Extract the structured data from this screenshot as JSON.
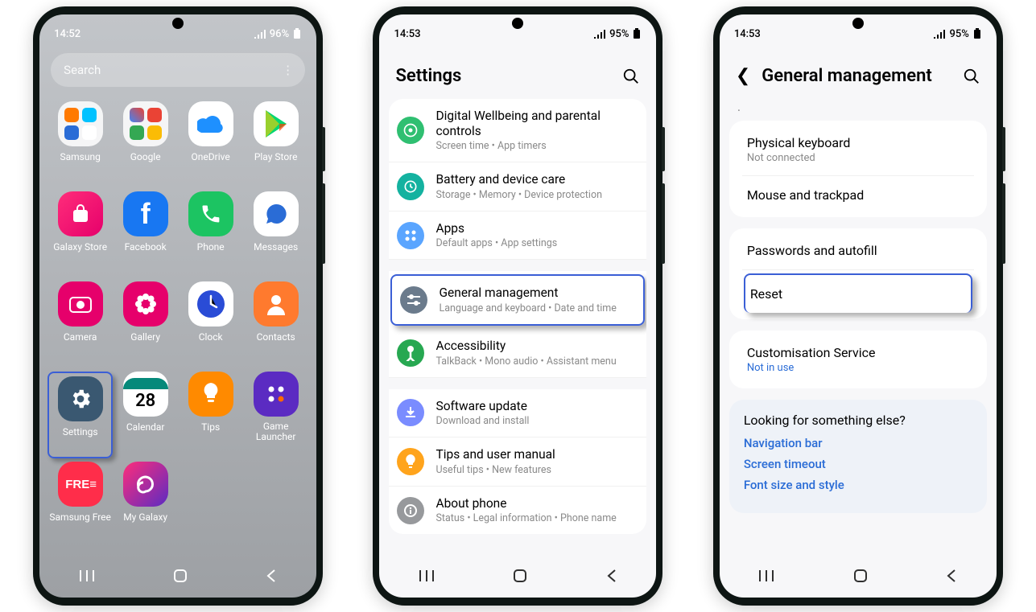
{
  "phone1": {
    "status": {
      "time": "14:52",
      "battery": "96%"
    },
    "search_placeholder": "Search",
    "apps": [
      {
        "label": "Samsung"
      },
      {
        "label": "Google"
      },
      {
        "label": "OneDrive"
      },
      {
        "label": "Play Store"
      },
      {
        "label": "Galaxy Store"
      },
      {
        "label": "Facebook"
      },
      {
        "label": "Phone"
      },
      {
        "label": "Messages"
      },
      {
        "label": "Camera"
      },
      {
        "label": "Gallery"
      },
      {
        "label": "Clock"
      },
      {
        "label": "Contacts"
      },
      {
        "label": "Settings",
        "highlight": true
      },
      {
        "label": "Calendar"
      },
      {
        "label": "Tips"
      },
      {
        "label": "Game Launcher"
      },
      {
        "label": "Samsung Free"
      },
      {
        "label": "My Galaxy"
      }
    ],
    "calendar_day": "28"
  },
  "phone2": {
    "status": {
      "time": "14:53",
      "battery": "95%"
    },
    "header": "Settings",
    "items": [
      {
        "title": "Digital Wellbeing and parental controls",
        "sub": "Screen time  •  App timers",
        "color": "#2fbf71"
      },
      {
        "title": "Battery and device care",
        "sub": "Storage  •  Memory  •  Device protection",
        "color": "#14b2a0"
      },
      {
        "title": "Apps",
        "sub": "Default apps  •  App settings",
        "color": "#5aa5ff"
      },
      {
        "title": "General management",
        "sub": "Language and keyboard  •  Date and time",
        "color": "#6b7b8c",
        "highlight": true
      },
      {
        "title": "Accessibility",
        "sub": "TalkBack  •  Mono audio  •  Assistant menu",
        "color": "#27a851"
      },
      {
        "title": "Software update",
        "sub": "Download and install",
        "color": "#7a8cff"
      },
      {
        "title": "Tips and user manual",
        "sub": "Useful tips  •  New features",
        "color": "#ffa41c"
      },
      {
        "title": "About phone",
        "sub": "Status  •  Legal information  •  Phone name",
        "color": "#97999c"
      }
    ]
  },
  "phone3": {
    "status": {
      "time": "14:53",
      "battery": "95%"
    },
    "header": "General management",
    "items": [
      {
        "title": "Physical keyboard",
        "sub": "Not connected"
      },
      {
        "title": "Mouse and trackpad"
      },
      {
        "title": "Passwords and autofill"
      },
      {
        "title": "Reset",
        "highlight": true
      },
      {
        "title": "Customisation Service",
        "sub": "Not in use",
        "subBlue": true
      }
    ],
    "looking": {
      "heading": "Looking for something else?",
      "links": [
        "Navigation bar",
        "Screen timeout",
        "Font size and style"
      ]
    }
  }
}
